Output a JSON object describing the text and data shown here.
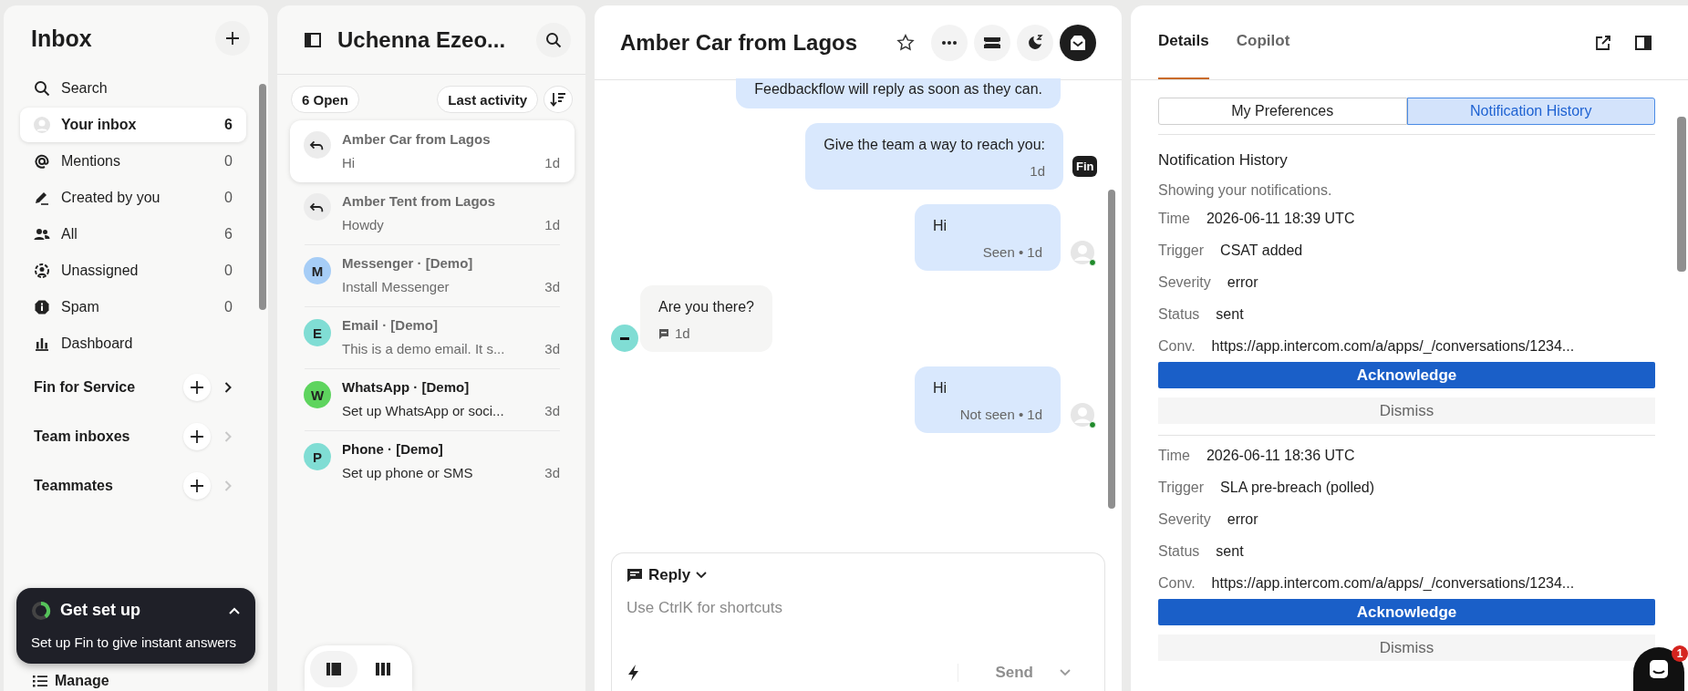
{
  "sidebar": {
    "title": "Inbox",
    "search": "Search",
    "items": [
      {
        "label": "Your inbox",
        "count": "6",
        "selected": true
      },
      {
        "label": "Mentions",
        "count": "0",
        "selected": false
      },
      {
        "label": "Created by you",
        "count": "0",
        "selected": false
      },
      {
        "label": "All",
        "count": "6",
        "selected": false
      },
      {
        "label": "Unassigned",
        "count": "0",
        "selected": false
      },
      {
        "label": "Spam",
        "count": "0",
        "selected": false
      },
      {
        "label": "Dashboard",
        "selected": false
      }
    ],
    "sections": [
      {
        "label": "Fin for Service",
        "enabled": true
      },
      {
        "label": "Team inboxes",
        "enabled": false
      },
      {
        "label": "Teammates",
        "enabled": false
      }
    ],
    "setup_card": {
      "title": "Get set up",
      "text": "Set up Fin to give instant answers"
    },
    "footer": "Manage"
  },
  "list": {
    "title": "Uchenna Ezeo...",
    "filter": "6 Open",
    "sort": "Last activity",
    "conversations": [
      {
        "kind": "reply",
        "title": "Amber Car from Lagos",
        "preview": "Hi",
        "time": "1d",
        "selected": true,
        "unread": false
      },
      {
        "kind": "reply",
        "title": "Amber Tent from Lagos",
        "preview": "Howdy",
        "time": "1d",
        "selected": false,
        "unread": false
      },
      {
        "kind": "letter",
        "initial": "M",
        "color": "#a6cdf6",
        "title": "Messenger · [Demo]",
        "preview": "Install Messenger",
        "time": "3d",
        "selected": false,
        "unread": false
      },
      {
        "kind": "letter",
        "initial": "E",
        "color": "#80ddd4",
        "title": "Email · [Demo]",
        "preview": "This is a demo email. It s...",
        "time": "3d",
        "selected": false,
        "unread": false
      },
      {
        "kind": "letter",
        "initial": "W",
        "color": "#5ed45e",
        "title": "WhatsApp · [Demo]",
        "preview": "Set up WhatsApp or soci...",
        "time": "3d",
        "selected": false,
        "unread": true
      },
      {
        "kind": "letter",
        "initial": "P",
        "color": "#80ddd4",
        "title": "Phone · [Demo]",
        "preview": "Set up phone or SMS",
        "time": "3d",
        "selected": false,
        "unread": true
      }
    ],
    "views": [
      {
        "selected": true
      },
      {
        "selected": false
      }
    ]
  },
  "conversation": {
    "title": "Amber Car from Lagos",
    "messages": [
      {
        "kind": "out",
        "text": "Feedbackflow will reply as soon as they can.",
        "avatar": false
      },
      {
        "kind": "out",
        "text": "Give the team a way to reach you:",
        "meta": "1d",
        "avatar": false,
        "badge": "Fin"
      },
      {
        "kind": "out",
        "text": "Hi",
        "meta": "Seen • 1d",
        "avatar": true
      },
      {
        "kind": "in",
        "text": "Are you there?",
        "meta": "1d"
      },
      {
        "kind": "out",
        "text": "Hi",
        "meta": "Not seen • 1d",
        "avatar": true
      }
    ],
    "composer": {
      "mode": "Reply",
      "placeholder": "Use CtrlK for shortcuts",
      "send": "Send"
    }
  },
  "details": {
    "tabs": [
      {
        "label": "Details",
        "selected": true
      },
      {
        "label": "Copilot",
        "selected": false
      }
    ],
    "segments": [
      {
        "label": "My Preferences",
        "selected": false
      },
      {
        "label": "Notification History",
        "selected": true
      }
    ],
    "heading": "Notification History",
    "subtitle": "Showing your notifications.",
    "notifications": [
      {
        "fields": [
          {
            "label": "Time",
            "value": "2026-06-11 18:39 UTC"
          },
          {
            "label": "Trigger",
            "value": "CSAT added"
          },
          {
            "label": "Severity",
            "value": "error"
          },
          {
            "label": "Status",
            "value": "sent"
          },
          {
            "label": "Conv.",
            "value": "https://app.intercom.com/a/apps/_/conversations/1234..."
          }
        ],
        "acknowledge": "Acknowledge",
        "dismiss": "Dismiss"
      },
      {
        "fields": [
          {
            "label": "Time",
            "value": "2026-06-11 18:36 UTC"
          },
          {
            "label": "Trigger",
            "value": "SLA pre-breach (polled)"
          },
          {
            "label": "Severity",
            "value": "error"
          },
          {
            "label": "Status",
            "value": "sent"
          },
          {
            "label": "Conv.",
            "value": "https://app.intercom.com/a/apps/_/conversations/1234..."
          }
        ],
        "acknowledge": "Acknowledge",
        "dismiss": "Dismiss"
      }
    ],
    "messenger_badge": "1"
  }
}
